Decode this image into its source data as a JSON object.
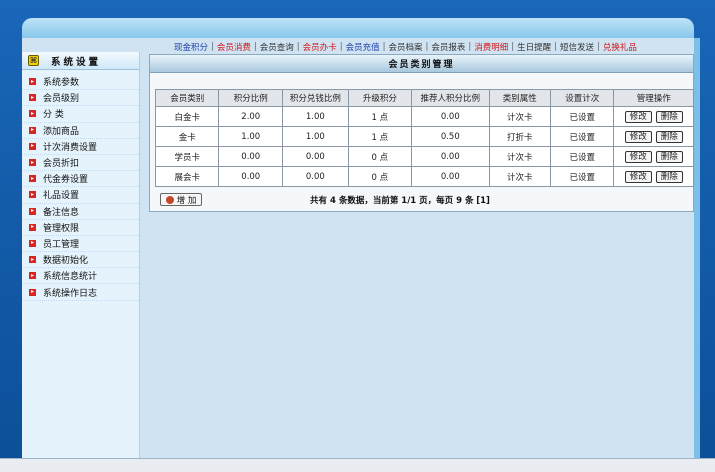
{
  "topnav": [
    {
      "label": "现金积分",
      "color": "blue"
    },
    {
      "label": "会员消费",
      "color": "red"
    },
    {
      "label": "会员查询",
      "color": "gray"
    },
    {
      "label": "会员办卡",
      "color": "red"
    },
    {
      "label": "会员充值",
      "color": "blue"
    },
    {
      "label": "会员档案",
      "color": "gray"
    },
    {
      "label": "会员报表",
      "color": "gray"
    },
    {
      "label": "消费明细",
      "color": "red"
    },
    {
      "label": "生日提醒",
      "color": "gray"
    },
    {
      "label": "短信发送",
      "color": "gray"
    },
    {
      "label": "兑换礼品",
      "color": "red"
    }
  ],
  "sidebar": {
    "title": "系统设置",
    "items": [
      "系统参数",
      "会员级别",
      "分 类",
      "添加商品",
      "计次消费设置",
      "会员折扣",
      "代金券设置",
      "礼品设置",
      "备注信息",
      "管理权限",
      "员工管理",
      "数据初始化",
      "系统信息统计",
      "系统操作日志"
    ]
  },
  "panel": {
    "title": "会员类别管理",
    "columns": [
      "会员类别",
      "积分比例",
      "积分兑钱比例",
      "升级积分",
      "推荐人积分比例",
      "类别属性",
      "设置计次",
      "管理操作"
    ],
    "rows": [
      {
        "name": "白金卡",
        "ratio": "2.00",
        "exchange": "1.00",
        "upgrade": "1 点",
        "referral": "0.00",
        "prop": "计次卡",
        "prop_color": "blue",
        "setting": "已设置"
      },
      {
        "name": "金卡",
        "ratio": "1.00",
        "exchange": "1.00",
        "upgrade": "1 点",
        "referral": "0.50",
        "prop": "打折卡",
        "prop_color": "purple",
        "setting": "已设置"
      },
      {
        "name": "学员卡",
        "ratio": "0.00",
        "exchange": "0.00",
        "upgrade": "0 点",
        "referral": "0.00",
        "prop": "计次卡",
        "prop_color": "blue",
        "setting": "已设置"
      },
      {
        "name": "展会卡",
        "ratio": "0.00",
        "exchange": "0.00",
        "upgrade": "0 点",
        "referral": "0.00",
        "prop": "计次卡",
        "prop_color": "blue",
        "setting": "已设置"
      }
    ],
    "edit_label": "修改",
    "delete_label": "删除",
    "add_label": "增 加",
    "pager": "共有 4 条数据，当前第 1/1 页，每页 9 条",
    "pager_page": "[1]"
  },
  "colors": {
    "frame_blue": "#0c4f98",
    "nav_blue": "#1b3fa8",
    "nav_red": "#d11a1a",
    "prop_blue": "#0d6f9c",
    "prop_purple": "#9a1c8f",
    "bullet_red": "#d8251f"
  }
}
